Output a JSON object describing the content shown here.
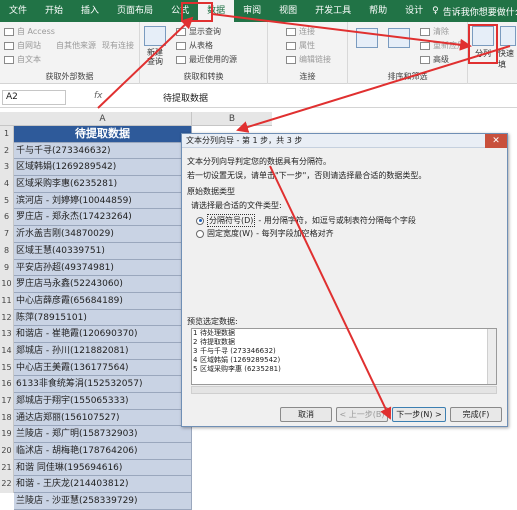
{
  "ribbon_tabs": [
    {
      "label": "文件"
    },
    {
      "label": "开始"
    },
    {
      "label": "插入"
    },
    {
      "label": "页面布局"
    },
    {
      "label": "公式"
    },
    {
      "label": "数据"
    },
    {
      "label": "审阅"
    },
    {
      "label": "视图"
    },
    {
      "label": "开发工具"
    },
    {
      "label": "帮助"
    },
    {
      "label": "设计"
    }
  ],
  "tell_me": "告诉我你想要做什么",
  "ribbon": {
    "external_data_items": [
      "自 Access",
      "自网站",
      "自文本"
    ],
    "external_data_mid": [
      "自其他来源",
      "现有连接"
    ],
    "group_external": "获取外部数据",
    "new_query": "新建\n查询",
    "query_items": [
      "显示查询",
      "从表格",
      "最近使用的源"
    ],
    "group_transform": "获取和转换",
    "connections_items": [
      "连接",
      "属性",
      "编辑链接"
    ],
    "group_connections": "连接",
    "sort_items": [
      "清除",
      "重新应用",
      "高级"
    ],
    "group_sort": "排序和筛选",
    "split_label": "分列",
    "quick_fill": "快速填"
  },
  "formula_bar": {
    "name_box": "A2",
    "fx": "fx",
    "content": "待提取数据"
  },
  "columns": [
    "A",
    "B"
  ],
  "rows": [
    "1",
    "2",
    "3",
    "4",
    "5",
    "6",
    "7",
    "8",
    "9",
    "10",
    "11",
    "12",
    "13",
    "14",
    "15",
    "16",
    "17",
    "18",
    "19",
    "20",
    "21",
    "22"
  ],
  "cells": [
    "待提取数据",
    "千与千寻(273346632)",
    "区域韩娟(1269289542)",
    "区域采购李惠(6235281)",
    "滨河店 - 刘婷婷(10044859)",
    "罗庄店 - 郑永杰(17423264)",
    "沂水盖吉刚(34870029)",
    "区域王慧(40339751)",
    "平安店孙超(49374981)",
    "罗庄店马永鑫(52243060)",
    "中心店薛彦霞(65684189)",
    "陈萍(78915101)",
    "和谐店 - 崔艳霞(120690370)",
    "郯城店 - 孙川(121882081)",
    "中心店王美霞(136177564)",
    "6133非食统筹涓(152532057)",
    "郯城店于翔宇(155065333)",
    "通达店郑丽(156107527)",
    "兰陵店 - 郑广明(158732903)",
    "临沭店 - 胡梅艳(178764206)",
    "和谐 同佳琳(195694616)",
    "和谐 - 王庆龙(214403812)",
    "兰陵店 - 沙亚慧(258339729)"
  ],
  "dialog": {
    "title": "文本分列向导 - 第 1 步，共 3 步",
    "line1": "文本分列向导判定您的数据具有分隔符。",
    "line2": "若一切设置无误，请单击\"下一步\"，否则请选择最合适的数据类型。",
    "section": "原始数据类型",
    "choose": "请选择最合适的文件类型:",
    "opt1_label": "分隔符号(D)",
    "opt1_desc": "- 用分隔字符，如逗号或制表符分隔每个字段",
    "opt2_label": "固定宽度(W)",
    "opt2_desc": "- 每列字段加空格对齐",
    "preview_label": "预览选定数据:",
    "preview_lines": [
      {
        "n": "1",
        "t": "待处理数据"
      },
      {
        "n": "2",
        "t": "待提取数据"
      },
      {
        "n": "3",
        "t": "千与千寻 (273346632)"
      },
      {
        "n": "4",
        "t": "区域韩娟 (1269289542)"
      },
      {
        "n": "5",
        "t": "区域采购李惠 (6235281)"
      }
    ],
    "btn_cancel": "取消",
    "btn_back": "< 上一步(B)",
    "btn_next": "下一步(N) >",
    "btn_finish": "完成(F)"
  },
  "colors": {
    "excel_green": "#217346",
    "header_blue": "#2e5a9a",
    "annotation_red": "#e03030"
  }
}
